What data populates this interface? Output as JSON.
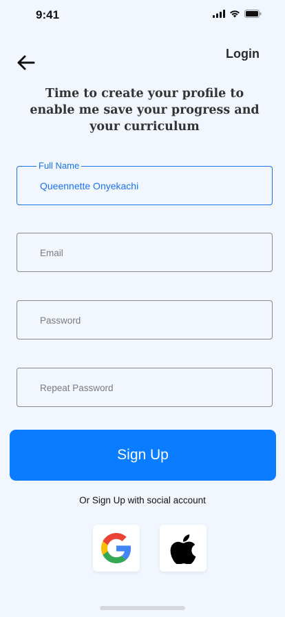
{
  "status_bar": {
    "time": "9:41",
    "icons": [
      "signal-icon",
      "wifi-icon",
      "battery-icon"
    ]
  },
  "nav": {
    "back_icon": "arrow-left-icon",
    "login_label": "Login"
  },
  "headline": "Time to create your profile to enable me save your progress and your curriculum",
  "form": {
    "full_name": {
      "label": "Full Name",
      "value": "Queennette Onyekachi"
    },
    "email": {
      "placeholder": "Email"
    },
    "password": {
      "placeholder": "Password"
    },
    "repeat_password": {
      "placeholder": "Repeat Password"
    }
  },
  "signup_label": "Sign Up",
  "social_text": "Or Sign Up with social account",
  "social": [
    {
      "icon": "google-icon"
    },
    {
      "icon": "apple-icon"
    }
  ],
  "colors": {
    "background": "#f2f7ff",
    "accent": "#0a7cff",
    "active_field": "#1a73e8"
  }
}
